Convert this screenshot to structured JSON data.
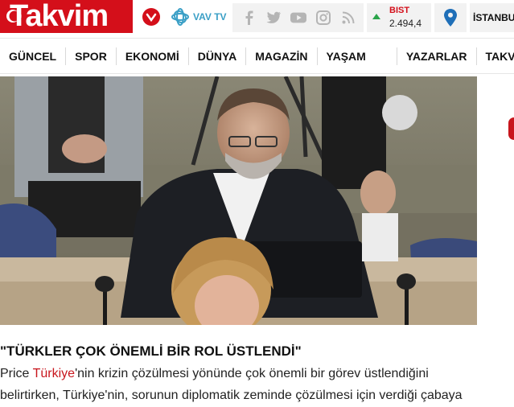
{
  "header": {
    "logo_text": "Takvim",
    "vavtv_label": "VAV TV",
    "social_icons": [
      "facebook-icon",
      "twitter-icon",
      "youtube-icon",
      "instagram-icon",
      "rss-icon"
    ],
    "bist": {
      "label": "BIST",
      "value": "2.494,4",
      "trend": "up"
    },
    "location_icon": "location-pin-icon",
    "city": "İSTANBUL"
  },
  "nav": {
    "items": [
      "GÜNCEL",
      "SPOR",
      "EKONOMİ",
      "DÜNYA",
      "MAGAZİN",
      "YAŞAM",
      "YAZARLAR",
      "TAKVİM TV"
    ]
  },
  "article": {
    "headline": "\"TÜRKLER ÇOK ÖNEMLİ BİR ROL ÜSTLENDİ\"",
    "line1_before": "Price ",
    "line1_link": "Türkiye",
    "line1_after": "'nin krizin çözülmesi yönünde çok önemli bir görev üstlendiğini",
    "line2": "belirtirken, Türkiye'nin, sorunun diplomatik zeminde çözülmesi için verdiği çabaya"
  },
  "colors": {
    "brand_red": "#d40f1a",
    "link_red": "#c8161d",
    "bist_up": "#2aa44a",
    "vavtv_blue": "#3a9fc6",
    "toolbar_bg": "#f2f2f2"
  }
}
